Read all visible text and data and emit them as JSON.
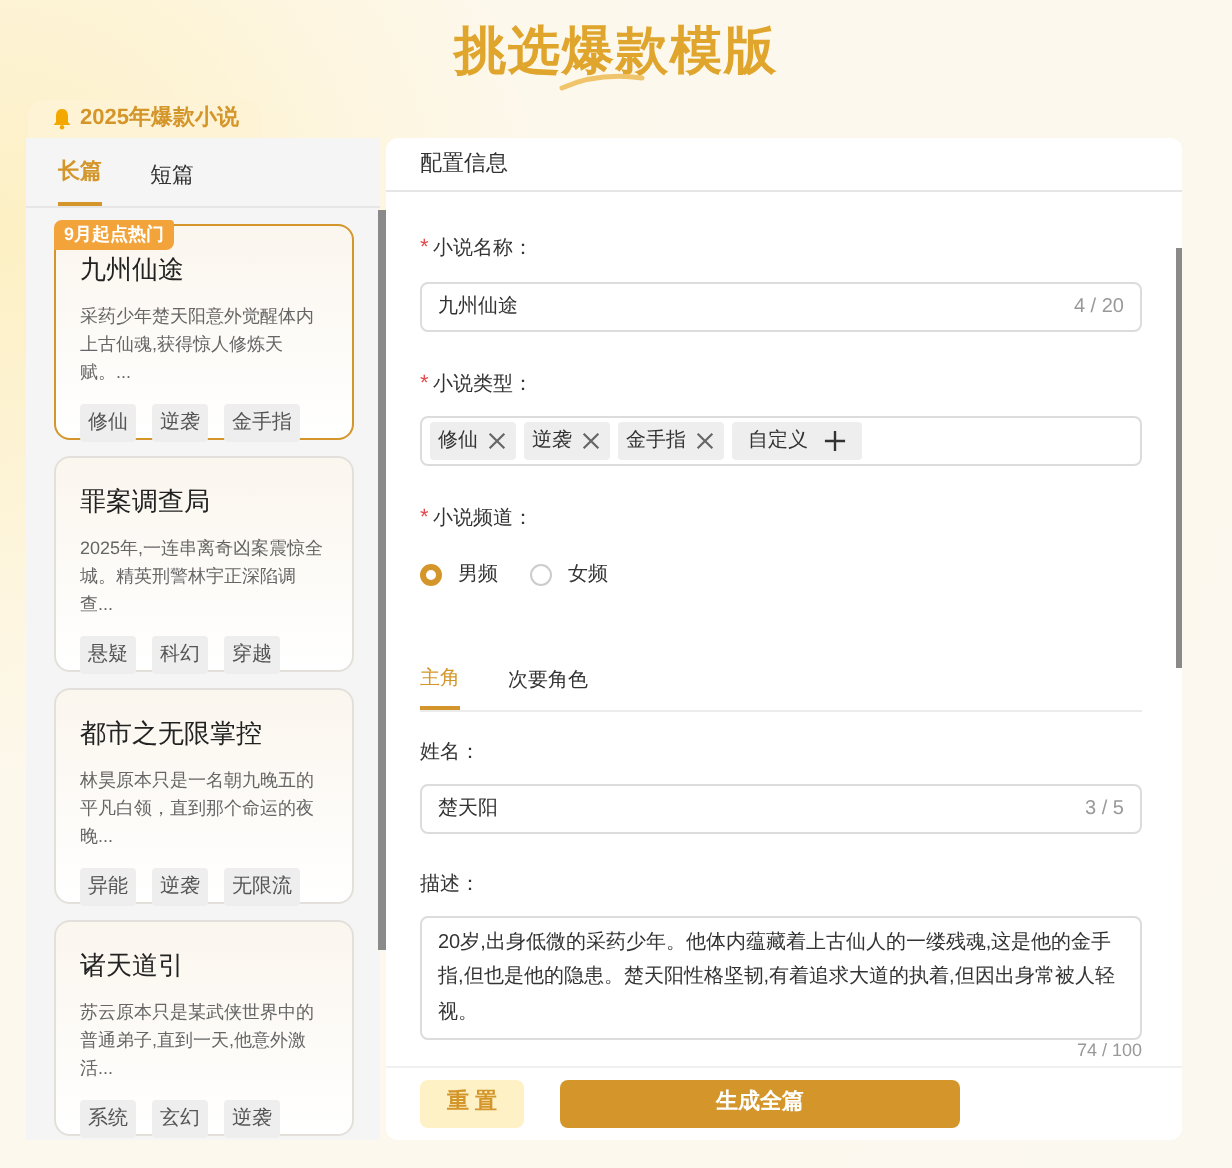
{
  "title": "挑选爆款模版",
  "category_badge": "2025年爆款小说",
  "left_tabs": [
    {
      "label": "长篇",
      "selected": true
    },
    {
      "label": "短篇",
      "selected": false
    }
  ],
  "templates": [
    {
      "badge": "9月起点热门",
      "title": "九州仙途",
      "description": "采药少年楚天阳意外觉醒体内上古仙魂,获得惊人修炼天赋。...",
      "tags": [
        "修仙",
        "逆袭",
        "金手指"
      ],
      "selected": true
    },
    {
      "title": "罪案调查局",
      "description": "2025年,一连串离奇凶案震惊全城。精英刑警林宇正深陷调查...",
      "tags": [
        "悬疑",
        "科幻",
        "穿越"
      ],
      "selected": false
    },
    {
      "title": "都市之无限掌控",
      "description": "林昊原本只是一名朝九晚五的平凡白领，直到那个命运的夜晚...",
      "tags": [
        "异能",
        "逆袭",
        "无限流"
      ],
      "selected": false
    },
    {
      "title": "诸天道引",
      "description": "苏云原本只是某武侠世界中的普通弟子,直到一天,他意外激活...",
      "tags": [
        "系统",
        "玄幻",
        "逆袭"
      ],
      "selected": false
    }
  ],
  "form": {
    "header": "配置信息",
    "name_field": {
      "mark": "*",
      "label": "小说名称：",
      "value": "九州仙途",
      "counter": "4 / 20"
    },
    "type_field": {
      "mark": "*",
      "label": "小说类型：",
      "tags": [
        "修仙",
        "逆袭",
        "金手指"
      ],
      "add_label": "自定义"
    },
    "channel_field": {
      "mark": "*",
      "label": "小说频道：",
      "options": [
        {
          "label": "男频",
          "selected": true
        },
        {
          "label": "女频",
          "selected": false
        }
      ]
    },
    "role_tabs": [
      {
        "label": "主角",
        "selected": true
      },
      {
        "label": "次要角色",
        "selected": false
      }
    ],
    "character": {
      "name_label": "姓名：",
      "name_value": "楚天阳",
      "name_counter": "3 / 5",
      "desc_label": "描述：",
      "desc_value": "20岁,出身低微的采药少年。他体内蕴藏着上古仙人的一缕残魂,这是他的金手指,但也是他的隐患。楚天阳性格坚韧,有着追求大道的执着,但因出身常被人轻视。",
      "desc_counter": "74 / 100"
    }
  },
  "buttons": {
    "reset": "重 置",
    "generate": "生成全篇"
  }
}
